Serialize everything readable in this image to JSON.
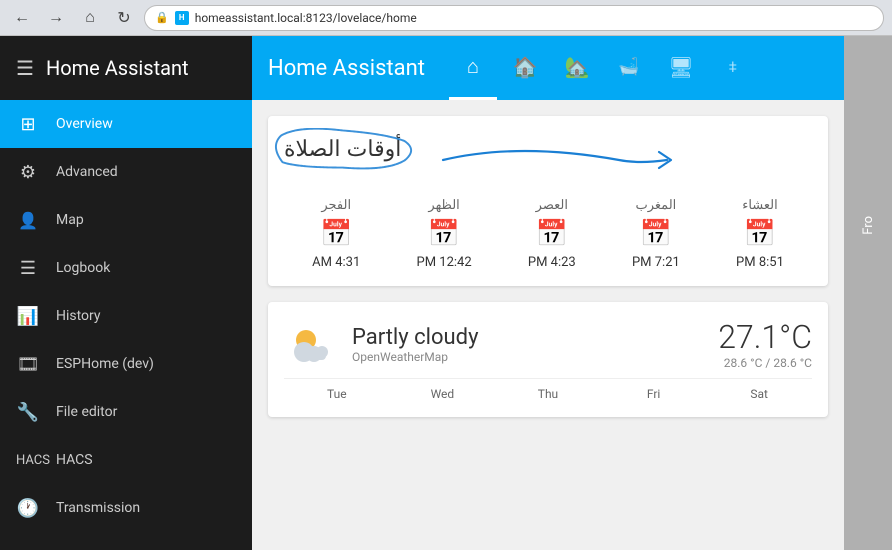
{
  "browser": {
    "url": "homeassistant.local:8123/lovelace/home",
    "lock_symbol": "🔒",
    "ha_favicon_text": "H"
  },
  "sidebar": {
    "title": "Home Assistant",
    "menu_symbol": "☰",
    "items": [
      {
        "id": "overview",
        "label": "Overview",
        "icon": "⊞",
        "active": true
      },
      {
        "id": "advanced",
        "label": "Advanced",
        "icon": "⚙",
        "active": false
      },
      {
        "id": "map",
        "label": "Map",
        "icon": "👤",
        "active": false
      },
      {
        "id": "logbook",
        "label": "Logbook",
        "icon": "☰",
        "active": false
      },
      {
        "id": "history",
        "label": "History",
        "icon": "📊",
        "active": false
      },
      {
        "id": "esphome",
        "label": "ESPHome (dev)",
        "icon": "🎞",
        "active": false
      },
      {
        "id": "file-editor",
        "label": "File editor",
        "icon": "🔧",
        "active": false
      },
      {
        "id": "hacs",
        "label": "HACS",
        "icon": "🎪",
        "active": false
      },
      {
        "id": "transmission",
        "label": "Transmission",
        "icon": "🕐",
        "active": false
      }
    ]
  },
  "topbar": {
    "title": "Home Assistant",
    "tabs": [
      {
        "id": "home",
        "symbol": "⌂",
        "active": true
      },
      {
        "id": "person",
        "symbol": "🏠",
        "active": false
      },
      {
        "id": "building",
        "symbol": "🏡",
        "active": false
      },
      {
        "id": "bathtub",
        "symbol": "🛁",
        "active": false
      },
      {
        "id": "monitor",
        "symbol": "🖥",
        "active": false
      },
      {
        "id": "network",
        "symbol": "⛶",
        "active": false
      }
    ]
  },
  "prayer_card": {
    "title": "أوقات الصلاة",
    "times": [
      {
        "name": "الفجر",
        "time": "4:31 AM"
      },
      {
        "name": "الظهر",
        "time": "12:42 PM"
      },
      {
        "name": "العصر",
        "time": "4:23 PM"
      },
      {
        "name": "المغرب",
        "time": "7:21 PM"
      },
      {
        "name": "العشاء",
        "time": "8:51 PM"
      }
    ]
  },
  "weather_card": {
    "condition": "Partly cloudy",
    "source": "OpenWeatherMap",
    "temperature": "27.1°C",
    "range": "28.6 °C / 28.6 °C",
    "days": [
      "Tue",
      "Wed",
      "Thu",
      "Fri",
      "Sat"
    ]
  },
  "right_panel": {
    "label": "Fro"
  },
  "accent_color": "#03a9f4"
}
